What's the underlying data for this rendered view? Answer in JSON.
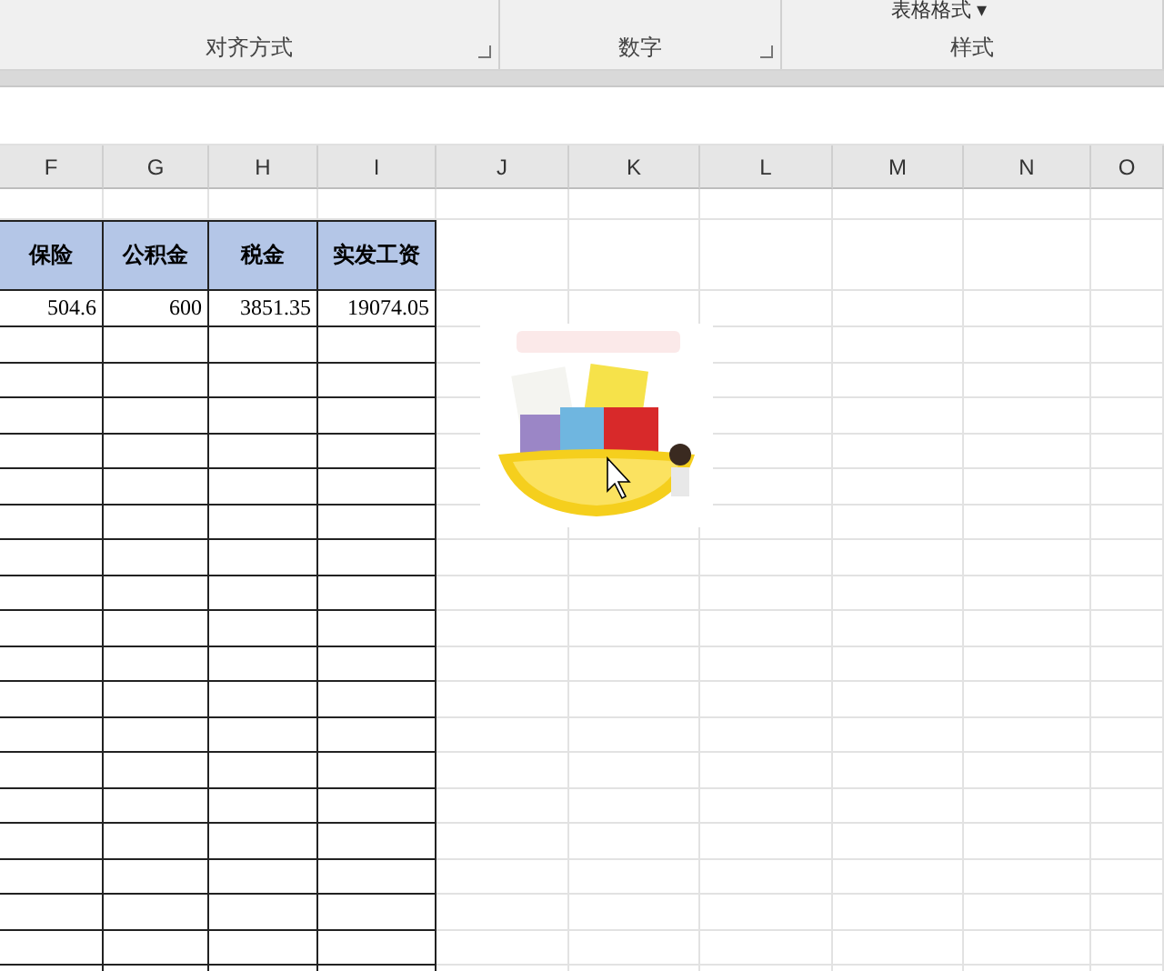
{
  "ribbon": {
    "style_button": "表格格式 ▾",
    "groups": [
      {
        "label": "对齐方式"
      },
      {
        "label": "数字"
      },
      {
        "label": "样式"
      }
    ]
  },
  "column_headers": [
    "F",
    "G",
    "H",
    "I",
    "J",
    "K",
    "L",
    "M",
    "N",
    "O"
  ],
  "table": {
    "columns": [
      "保险",
      "公积金",
      "税金",
      "实发工资"
    ],
    "rows": [
      [
        "504.6",
        "600",
        "3851.35",
        "19074.05"
      ]
    ]
  }
}
